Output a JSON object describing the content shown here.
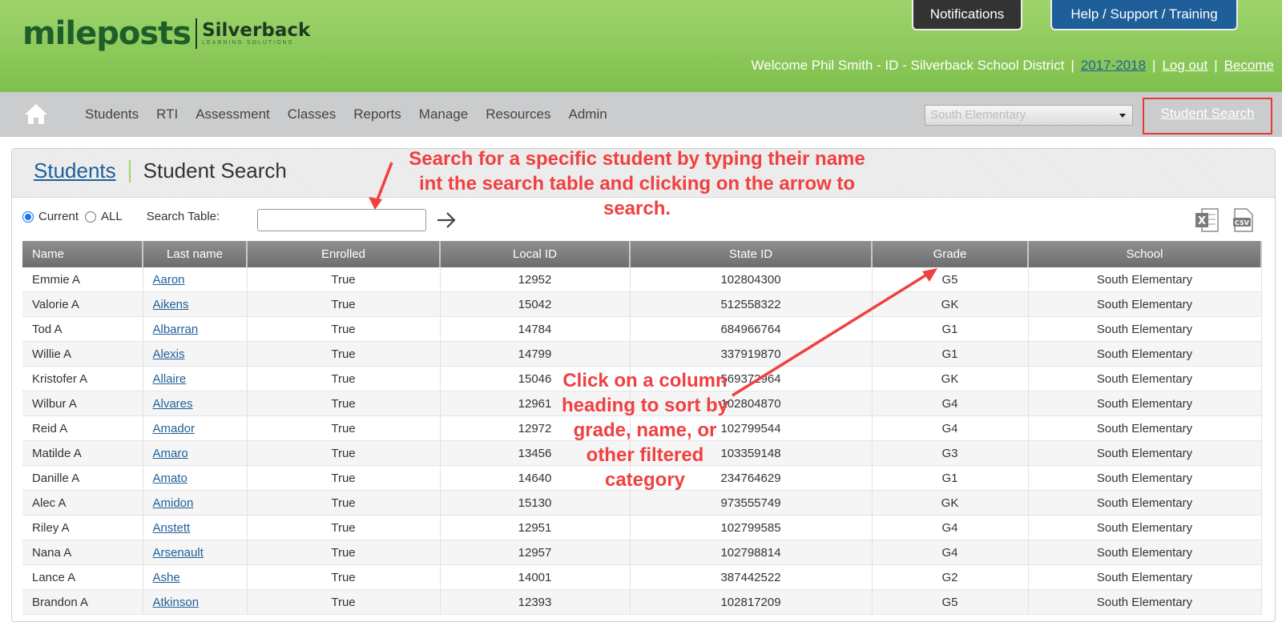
{
  "header": {
    "logo_main": "mileposts",
    "logo_sub": "Silverback",
    "logo_tagline": "LEARNING SOLUTIONS",
    "notifications_label": "Notifications",
    "help_label": "Help / Support / Training",
    "welcome_text": "Welcome Phil Smith - ID - Silverback School District",
    "year_link": "2017-2018",
    "logout_link": "Log out",
    "become_link": "Become",
    "separator": "|"
  },
  "nav": {
    "items": [
      "Students",
      "RTI",
      "Assessment",
      "Classes",
      "Reports",
      "Manage",
      "Resources",
      "Admin"
    ],
    "school_select": "South Elementary",
    "student_search": "Student Search"
  },
  "page": {
    "breadcrumb_link": "Students",
    "title": "Student Search"
  },
  "filters": {
    "current_label": "Current",
    "all_label": "ALL",
    "search_label": "Search Table:",
    "search_value": ""
  },
  "table": {
    "columns": [
      "Name",
      "Last name",
      "Enrolled",
      "Local ID",
      "State ID",
      "Grade",
      "School"
    ],
    "rows": [
      [
        "Emmie A",
        "Aaron",
        "True",
        "12952",
        "102804300",
        "G5",
        "South Elementary"
      ],
      [
        "Valorie A",
        "Aikens",
        "True",
        "15042",
        "512558322",
        "GK",
        "South Elementary"
      ],
      [
        "Tod A",
        "Albarran",
        "True",
        "14784",
        "684966764",
        "G1",
        "South Elementary"
      ],
      [
        "Willie A",
        "Alexis",
        "True",
        "14799",
        "337919870",
        "G1",
        "South Elementary"
      ],
      [
        "Kristofer A",
        "Allaire",
        "True",
        "15046",
        "569372964",
        "GK",
        "South Elementary"
      ],
      [
        "Wilbur A",
        "Alvares",
        "True",
        "12961",
        "102804870",
        "G4",
        "South Elementary"
      ],
      [
        "Reid A",
        "Amador",
        "True",
        "12972",
        "102799544",
        "G4",
        "South Elementary"
      ],
      [
        "Matilde A",
        "Amaro",
        "True",
        "13456",
        "103359148",
        "G3",
        "South Elementary"
      ],
      [
        "Danille A",
        "Amato",
        "True",
        "14640",
        "234764629",
        "G1",
        "South Elementary"
      ],
      [
        "Alec A",
        "Amidon",
        "True",
        "15130",
        "973555749",
        "GK",
        "South Elementary"
      ],
      [
        "Riley A",
        "Anstett",
        "True",
        "12951",
        "102799585",
        "G4",
        "South Elementary"
      ],
      [
        "Nana A",
        "Arsenault",
        "True",
        "12957",
        "102798814",
        "G4",
        "South Elementary"
      ],
      [
        "Lance A",
        "Ashe",
        "True",
        "14001",
        "387442522",
        "G2",
        "South Elementary"
      ],
      [
        "Brandon A",
        "Atkinson",
        "True",
        "12393",
        "102817209",
        "G5",
        "South Elementary"
      ]
    ]
  },
  "annotations": {
    "search_note": "Search for a specific student by typing their name int the search table and clicking on the arrow to search.",
    "sort_note": "Click on a column heading to sort by grade, name, or other filtered category"
  },
  "colors": {
    "header_green": "#8cc95a",
    "nav_gray": "#cbcccd",
    "link_blue": "#1f5f99",
    "annotation_red": "#f04040"
  }
}
